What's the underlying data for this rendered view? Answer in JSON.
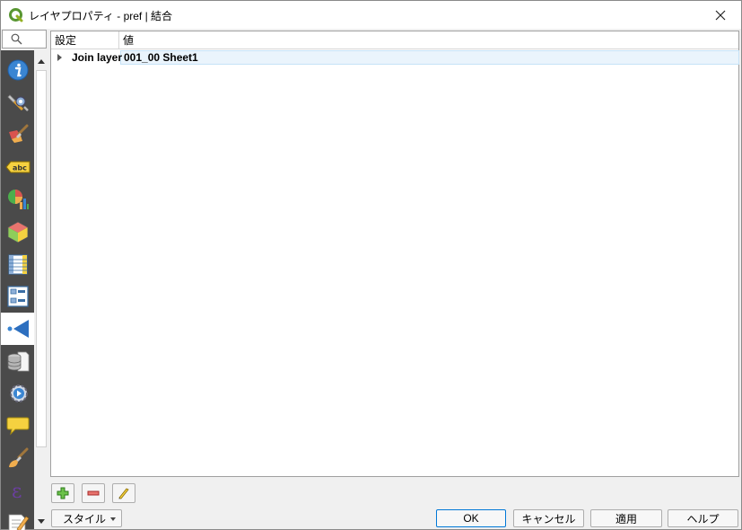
{
  "window": {
    "title": "レイヤプロパティ - pref | 結合"
  },
  "sidebar": {
    "items": [
      {
        "name": "information-icon",
        "active": false
      },
      {
        "name": "source-settings-icon",
        "active": false
      },
      {
        "name": "symbology-icon",
        "active": false
      },
      {
        "name": "labels-icon",
        "active": false
      },
      {
        "name": "diagrams-icon",
        "active": false
      },
      {
        "name": "3d-view-icon",
        "active": false
      },
      {
        "name": "fields-icon",
        "active": false
      },
      {
        "name": "attributes-form-icon",
        "active": false
      },
      {
        "name": "joins-icon",
        "active": true
      },
      {
        "name": "auxiliary-storage-icon",
        "active": false
      },
      {
        "name": "actions-icon",
        "active": false
      },
      {
        "name": "display-tips-icon",
        "active": false
      },
      {
        "name": "rendering-icon",
        "active": false
      },
      {
        "name": "variables-icon",
        "active": false
      },
      {
        "name": "metadata-icon",
        "active": false
      }
    ]
  },
  "tree": {
    "columns": [
      "設定",
      "値"
    ],
    "rows": [
      {
        "label": "Join layer",
        "value": "001_00 Sheet1"
      }
    ]
  },
  "buttons": {
    "style": "スタイル",
    "ok": "OK",
    "cancel": "キャンセル",
    "apply": "適用",
    "help": "ヘルプ"
  },
  "colors": {
    "accent": "#0078d7",
    "sidebar_bg": "#4a4a4a",
    "selection_bg": "#eaf4fc"
  }
}
